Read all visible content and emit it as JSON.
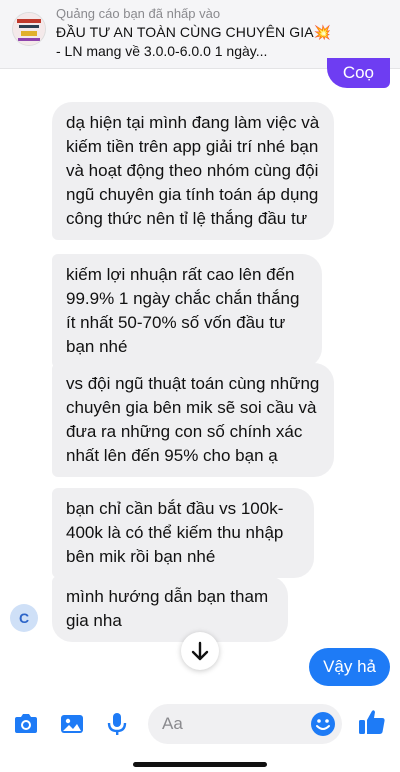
{
  "ad": {
    "label": "Quảng cáo bạn đã nhấp vào",
    "title": "ĐẦU TƯ AN TOÀN CÙNG CHUYÊN GIA💥",
    "description": "- LN mang về 3.0.0-6.0.0 1 ngày..."
  },
  "messages": {
    "outgoing_peek": "Coọ",
    "m1": "dạ hiện tại mình đang làm việc và kiếm tiền trên app giải trí nhé bạn và hoạt động theo nhóm cùng đội ngũ  chuyên gia tính toán áp dụng công thức nên tỉ lệ thắng đầu tư",
    "m2": "kiếm lợi nhuận rất cao lên đến 99.9%  1 ngày chắc chắn thắng ít nhất 50-70% số vốn đầu tư bạn nhé",
    "m3": "vs đội ngũ thuật toán cùng những chuyên gia bên mik sẽ soi cầu và đưa ra những con số chính xác nhất lên đến 95% cho bạn ạ",
    "m4": "bạn chỉ cần bắt đầu vs 100k-400k là có thể kiếm thu nhập bên mik rồi bạn nhé",
    "m5": "mình hướng dẫn bạn tham gia nha",
    "reply": "Vậy hả"
  },
  "avatar_letter": "C",
  "composer": {
    "placeholder": "Aa",
    "icons": [
      "camera-icon",
      "photo-icon",
      "microphone-icon",
      "emoji-icon",
      "thumbs-up-icon"
    ]
  },
  "colors": {
    "incoming_bubble": "#efeff1",
    "outgoing_bubble": "#1e7bf6",
    "outgoing_peek": "#6e3df2",
    "accent": "#1e7bf6"
  }
}
